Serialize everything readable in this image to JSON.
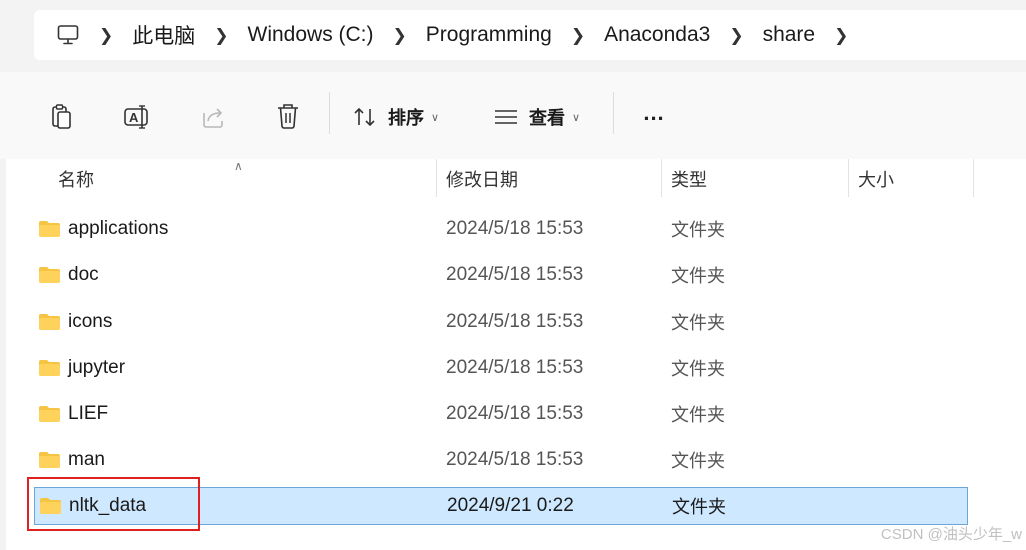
{
  "address": {
    "crumbs": [
      "此电脑",
      "Windows (C:)",
      "Programming",
      "Anaconda3",
      "share"
    ]
  },
  "toolbar": {
    "sort_label": "排序",
    "view_label": "查看",
    "more_label": "..."
  },
  "columns": {
    "name": "名称",
    "date": "修改日期",
    "type": "类型",
    "size": "大小"
  },
  "rows": [
    {
      "name": "applications",
      "date": "2024/5/18 15:53",
      "type": "文件夹",
      "selected": false
    },
    {
      "name": "doc",
      "date": "2024/5/18 15:53",
      "type": "文件夹",
      "selected": false
    },
    {
      "name": "icons",
      "date": "2024/5/18 15:53",
      "type": "文件夹",
      "selected": false
    },
    {
      "name": "jupyter",
      "date": "2024/5/18 15:53",
      "type": "文件夹",
      "selected": false
    },
    {
      "name": "LIEF",
      "date": "2024/5/18 15:53",
      "type": "文件夹",
      "selected": false
    },
    {
      "name": "man",
      "date": "2024/5/18 15:53",
      "type": "文件夹",
      "selected": false
    },
    {
      "name": "nltk_data",
      "date": "2024/9/21 0:22",
      "type": "文件夹",
      "selected": true
    }
  ],
  "watermark": "CSDN @油头少年_w",
  "colors": {
    "folder": "#f6c443",
    "selection": "#cde8ff",
    "annotation_box": "#e02020"
  },
  "icons": {
    "computer": "computer-icon",
    "copy": "copy-icon",
    "rename": "rename-icon",
    "share": "share-icon",
    "delete": "delete-icon",
    "sort": "sort-icon",
    "view": "view-icon",
    "folder": "folder-icon"
  }
}
